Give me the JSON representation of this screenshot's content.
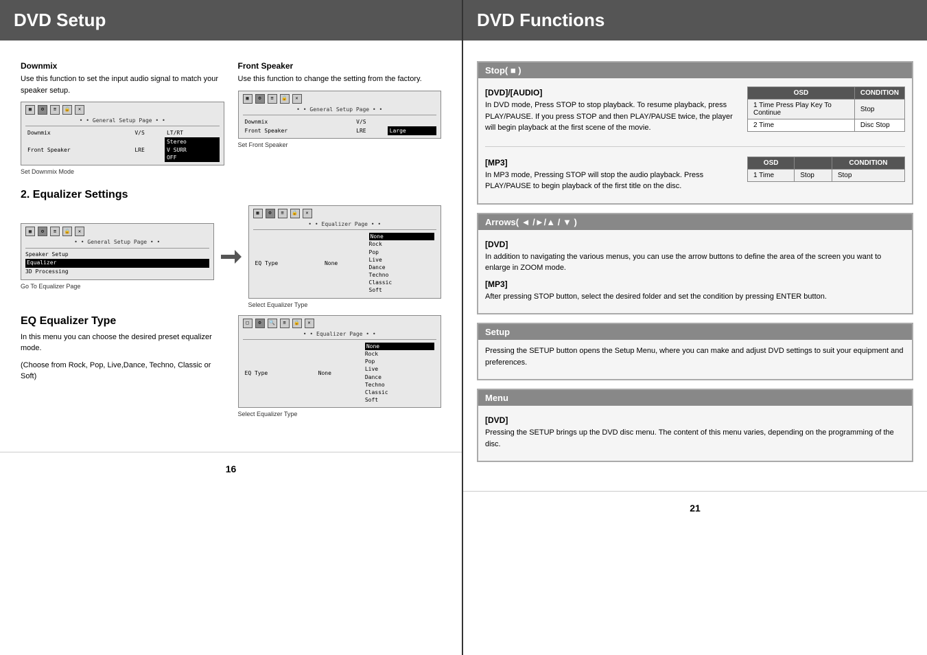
{
  "left": {
    "header": "DVD Setup",
    "page_number": "16",
    "sections": {
      "downmix": {
        "label": "Downmix",
        "text": "Use this function to set the input audio signal to match your speaker setup.",
        "caption": "Set Downmix Mode",
        "screen": {
          "nav": "• • General Setup Page • •",
          "rows": [
            {
              "col1": "Downmix",
              "col2": "V/S",
              "col3": "LT/RT"
            },
            {
              "col1": "Front Speaker",
              "col2": "LRE",
              "col3": "Stereo\nV SURR\nOFF"
            }
          ]
        }
      },
      "front_speaker": {
        "label": "Front Speaker",
        "text": "Use this function to change the setting from the factory.",
        "caption": "Set Front Speaker",
        "screen": {
          "nav": "• • General Setup Page • •",
          "rows": [
            {
              "col1": "Downmix",
              "col2": "V/S",
              "col3": ""
            },
            {
              "col1": "Front Speaker",
              "col2": "LRE",
              "col3": "Large"
            }
          ]
        }
      },
      "equalizer_settings": {
        "label": "2. Equalizer Settings",
        "screen1": {
          "nav": "• • General Setup Page • •",
          "rows": [
            "Speaker Setup",
            "Equalizer",
            "3D Processing"
          ],
          "caption": "Go To Equalizer Page"
        },
        "screen2": {
          "nav": "• • Equalizer Page • •",
          "col_header": [
            "EQ Type",
            "None"
          ],
          "options": [
            "None",
            "Rock",
            "Pop",
            "Live",
            "Dance",
            "Techno",
            "Classic",
            "Soft"
          ],
          "caption": "Select Equalizer Type"
        }
      },
      "eq_type": {
        "label": "EQ Equalizer Type",
        "text1": "In this menu you can choose the desired preset equalizer mode.",
        "text2": "(Choose from Rock, Pop, Live,Dance, Techno, Classic or Soft)",
        "screen": {
          "nav": "• • Equalizer Page • •",
          "col_header": [
            "EQ Type",
            "None"
          ],
          "options": [
            "None",
            "Rock",
            "Pop",
            "Live",
            "Dance",
            "Techno",
            "Classic",
            "Soft"
          ],
          "caption": "Select Equalizer Type"
        }
      }
    }
  },
  "right": {
    "header": "DVD Functions",
    "page_number": "21",
    "sections": {
      "stop": {
        "label": "Stop( ■ )",
        "dvd_audio": {
          "label": "[DVD]/[AUDIO]",
          "text": "In DVD mode, Press STOP to stop playback. To resume playback, press PLAY/PAUSE. If you press STOP and then PLAY/PAUSE twice, the player will begin playback at the first scene of the movie.",
          "table": {
            "headers": [
              "OSD",
              "CONDITION"
            ],
            "rows": [
              {
                "osd": "1 Time Press Play Key To Continue",
                "condition": "Stop"
              },
              {
                "osd": "2 Time",
                "condition": "Disc Stop"
              }
            ]
          }
        },
        "mp3": {
          "label": "[MP3]",
          "text": "In MP3 mode, Pressing STOP will stop the audio playback. Press PLAY/PAUSE to begin playback of the first title on the disc.",
          "table": {
            "headers": [
              "OSD",
              "CONDITION"
            ],
            "rows": [
              {
                "col1": "1 Time",
                "col2": "Stop",
                "condition": "Stop"
              }
            ]
          }
        }
      },
      "arrows": {
        "label": "Arrows( ◄ /►/▲ / ▼ )",
        "dvd": {
          "label": "[DVD]",
          "text": "In addition to navigating the various menus, you can use the arrow buttons to define the area of the screen you want to enlarge in ZOOM mode."
        },
        "mp3": {
          "label": "[MP3]",
          "text": "After pressing STOP button, select the desired folder and set the condition by pressing ENTER button."
        }
      },
      "setup": {
        "label": "Setup",
        "text": "Pressing the SETUP button opens the Setup Menu, where you can make and adjust DVD settings to suit your equipment and preferences."
      },
      "menu": {
        "label": "Menu",
        "dvd": {
          "label": "[DVD]",
          "text": "Pressing the SETUP brings up the DVD disc menu. The content of this menu varies, depending on the programming of the disc."
        }
      }
    }
  }
}
